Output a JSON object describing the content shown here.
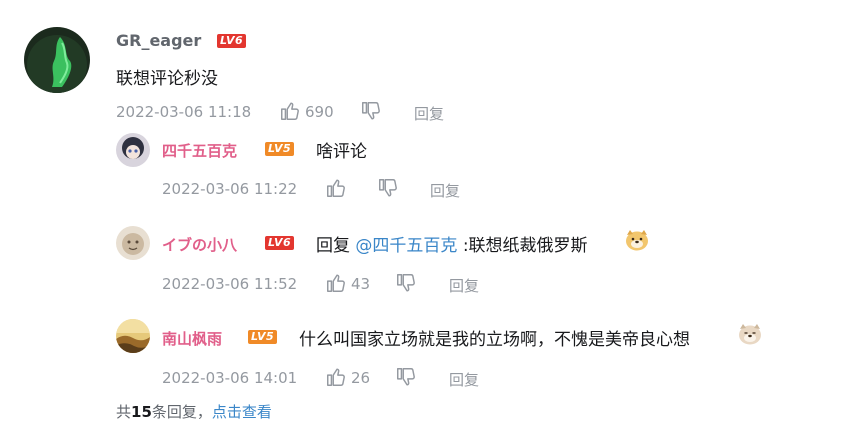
{
  "main_comment": {
    "username": "GR_eager",
    "level": "LV6",
    "content": "联想评论秒没",
    "time": "2022-03-06 11:18",
    "likes": "690",
    "reply_label": "回复"
  },
  "replies": [
    {
      "username": "四千五百克",
      "level": "LV5",
      "content": "啥评论",
      "time": "2022-03-06 11:22",
      "likes": "",
      "reply_label": "回复"
    },
    {
      "username": "イブの小八",
      "level": "LV6",
      "prefix": "回复",
      "mention": "@四千五百克",
      "content": ":联想纸裁俄罗斯",
      "time": "2022-03-06 11:52",
      "likes": "43",
      "reply_label": "回复"
    },
    {
      "username": "南山枫雨",
      "level": "LV5",
      "content": "什么叫国家立场就是我的立场啊，不愧是美帝良心想",
      "time": "2022-03-06 14:01",
      "likes": "26",
      "reply_label": "回复"
    }
  ],
  "footer": {
    "prefix": "共",
    "count": "15",
    "suffix": "条回复，",
    "link": "点击查看"
  },
  "colors": {
    "username_main": "#61666d",
    "username_sub": "#e15f8a",
    "mention": "#3a86c8",
    "meta": "#9499a0",
    "lv6": "#e3362f",
    "lv5": "#f08a27"
  }
}
